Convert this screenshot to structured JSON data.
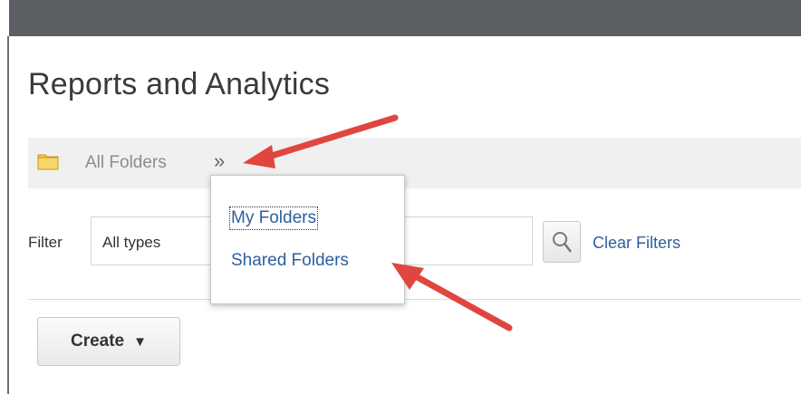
{
  "page": {
    "title": "Reports and Analytics"
  },
  "breadcrumb": {
    "root_label": "All Folders",
    "chevron": "»",
    "icon": "folder-icon"
  },
  "filter": {
    "label": "Filter",
    "type_value": "All types",
    "search_icon": "search-icon",
    "clear_label": "Clear Filters"
  },
  "dropdown": {
    "items": [
      {
        "label": "My Folders"
      },
      {
        "label": "Shared Folders"
      }
    ]
  },
  "toolbar": {
    "create_label": "Create",
    "create_caret": "▼"
  },
  "colors": {
    "link": "#2e5f9e",
    "annotation_arrow": "#e0463f",
    "topbar": "#5b5e63"
  }
}
